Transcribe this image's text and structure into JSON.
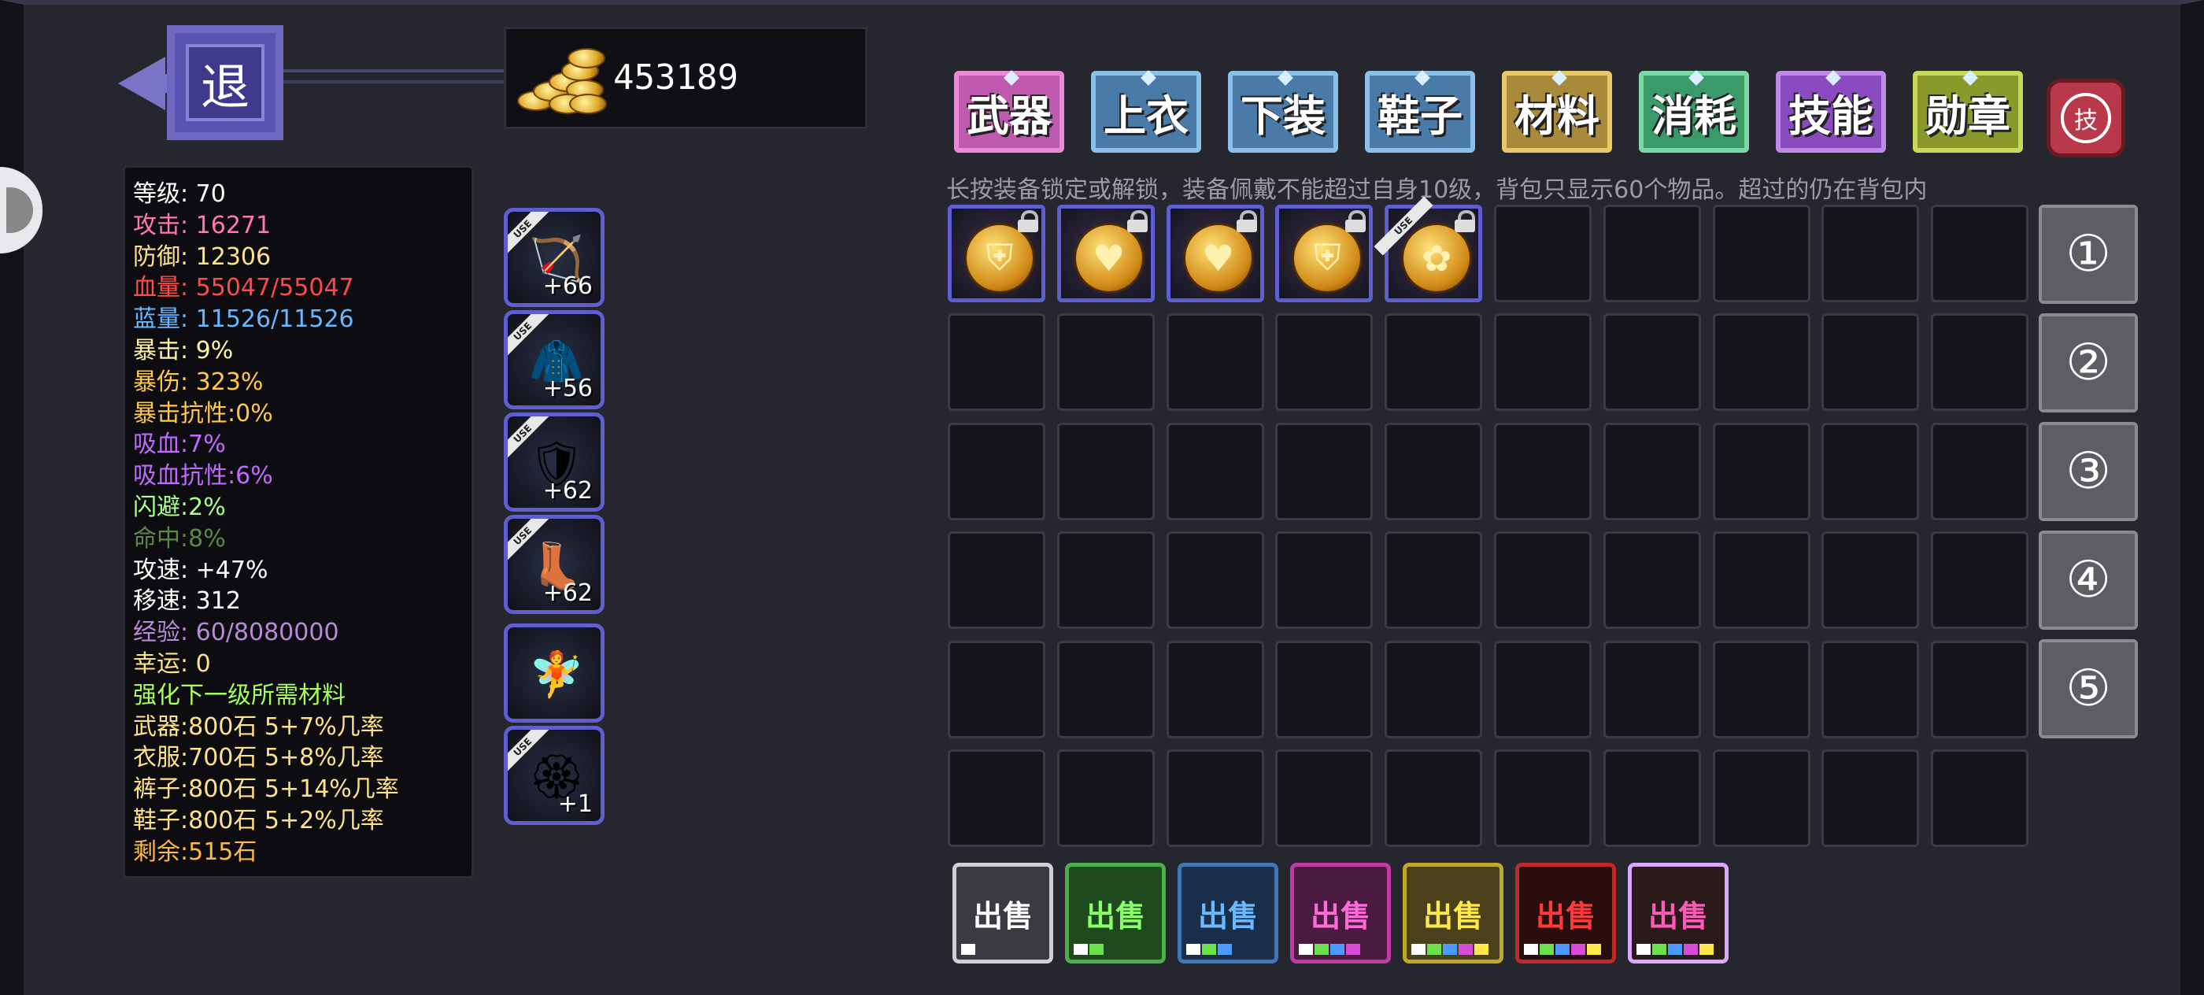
{
  "back_button": {
    "label": "退"
  },
  "gold": {
    "amount": "453189"
  },
  "stats": [
    {
      "text": "等级: 70",
      "color": "#ffffff"
    },
    {
      "text": "攻击: 16271",
      "color": "#ff7aa8"
    },
    {
      "text": "防御: 12306",
      "color": "#ffe28a"
    },
    {
      "text": "血量: 55047/55047",
      "color": "#ff4a4a"
    },
    {
      "text": "蓝量: 11526/11526",
      "color": "#6ab6ff"
    },
    {
      "text": "暴击: 9%",
      "color": "#fff6a8"
    },
    {
      "text": "暴伤: 323%",
      "color": "#ffc84a"
    },
    {
      "text": "暴击抗性:0%",
      "color": "#ffc84a"
    },
    {
      "text": "吸血:7%",
      "color": "#c06aff"
    },
    {
      "text": "吸血抗性:6%",
      "color": "#c06aff"
    },
    {
      "text": "闪避:2%",
      "color": "#a8ff8a"
    },
    {
      "text": "命中:8%",
      "color": "#5a8a4a"
    },
    {
      "text": "攻速: +47%",
      "color": "#ffffff"
    },
    {
      "text": "移速: 312",
      "color": "#ffffff"
    },
    {
      "text": "经验: 60/8080000",
      "color": "#b88ad8"
    },
    {
      "text": "幸运: 0",
      "color": "#ffe28a"
    },
    {
      "text": "强化下一级所需材料",
      "color": "#a8ff5a"
    },
    {
      "text": "武器:800石 5+7%几率",
      "color": "#ffe28a"
    },
    {
      "text": "衣服:700石 5+8%几率",
      "color": "#ffe28a"
    },
    {
      "text": "裤子:800石 5+14%几率",
      "color": "#ffe28a"
    },
    {
      "text": "鞋子:800石 5+2%几率",
      "color": "#ffe28a"
    },
    {
      "text": "剩余:515石",
      "color": "#ffb84a"
    }
  ],
  "equipped": [
    {
      "slot": "weapon",
      "icon": "bow-icon",
      "level": "+66",
      "use_tag": "USE"
    },
    {
      "slot": "top",
      "icon": "jacket-icon",
      "level": "+56",
      "use_tag": "USE"
    },
    {
      "slot": "pants",
      "icon": "armor-icon",
      "level": "+62",
      "use_tag": "USE"
    },
    {
      "slot": "shoes",
      "icon": "boots-icon",
      "level": "+62",
      "use_tag": "USE"
    },
    {
      "slot": "pet",
      "icon": "fairy-icon",
      "level": "",
      "use_tag": ""
    },
    {
      "slot": "medal",
      "icon": "medal-icon",
      "level": "+1",
      "use_tag": "USE"
    }
  ],
  "tabs": [
    {
      "label": "武器",
      "color": "#c05ab0",
      "border": "#e88ad8"
    },
    {
      "label": "上衣",
      "color": "#4a7aa8",
      "border": "#8ac0e8"
    },
    {
      "label": "下装",
      "color": "#4a7aa8",
      "border": "#8ac0e8"
    },
    {
      "label": "鞋子",
      "color": "#4a7aa8",
      "border": "#8ac0e8"
    },
    {
      "label": "材料",
      "color": "#a88a3a",
      "border": "#e8c86a"
    },
    {
      "label": "消耗",
      "color": "#3a9a6a",
      "border": "#7ad8a8"
    },
    {
      "label": "技能",
      "color": "#8a4ac0",
      "border": "#c08ae8"
    },
    {
      "label": "勋章",
      "color": "#8a9a2a",
      "border": "#c8d85a"
    }
  ],
  "refresh_button": {
    "label": "技"
  },
  "hint": "长按装备锁定或解锁，装备佩戴不能超过自身10级，背包只显示60个物品。超过的仍在背包内",
  "inventory": [
    {
      "icon": "shield-emblem-icon",
      "glyph": "⛨",
      "locked": true
    },
    {
      "icon": "heart-emblem-icon",
      "glyph": "♥",
      "locked": true
    },
    {
      "icon": "heart-emblem-icon",
      "glyph": "♥",
      "locked": true
    },
    {
      "icon": "shield-emblem-icon",
      "glyph": "⛨",
      "locked": true
    },
    {
      "icon": "medal-icon",
      "glyph": "✿",
      "locked": true,
      "use_tag": "USE"
    }
  ],
  "pages": [
    "①",
    "②",
    "③",
    "④",
    "⑤"
  ],
  "sell_buttons": [
    {
      "label": "出售",
      "text_color": "#ffffff",
      "border": "#cfcfd6",
      "bg": "#3a3a40",
      "dots": [
        "#ffffff"
      ]
    },
    {
      "label": "出售",
      "text_color": "#8aff6a",
      "border": "#4ab04a",
      "bg": "#1e4a1e",
      "dots": [
        "#ffffff",
        "#6ae04a"
      ]
    },
    {
      "label": "出售",
      "text_color": "#6ab8ff",
      "border": "#3a78b8",
      "bg": "#1a2e4a",
      "dots": [
        "#ffffff",
        "#6ae04a",
        "#4a9aff"
      ]
    },
    {
      "label": "出售",
      "text_color": "#ff6ad8",
      "border": "#c03aa8",
      "bg": "#4a1a40",
      "dots": [
        "#ffffff",
        "#6ae04a",
        "#4a9aff",
        "#d84ad8"
      ]
    },
    {
      "label": "出售",
      "text_color": "#ffe84a",
      "border": "#c0a82a",
      "bg": "#4a401a",
      "dots": [
        "#ffffff",
        "#6ae04a",
        "#4a9aff",
        "#d84ad8",
        "#ffe84a"
      ]
    },
    {
      "label": "出售",
      "text_color": "#ff3a3a",
      "border": "#c02a2a",
      "bg": "#2a0e0e",
      "dots": [
        "#ffffff",
        "#6ae04a",
        "#4a9aff",
        "#d84ad8",
        "#ffe84a"
      ]
    },
    {
      "label": "出售",
      "text_color": "#ff5ab8",
      "border": "#d8a8ff",
      "bg": "#2a1a1a",
      "dots": [
        "#ffffff",
        "#6ae04a",
        "#4a9aff",
        "#d84ad8",
        "#ffe84a"
      ]
    }
  ]
}
